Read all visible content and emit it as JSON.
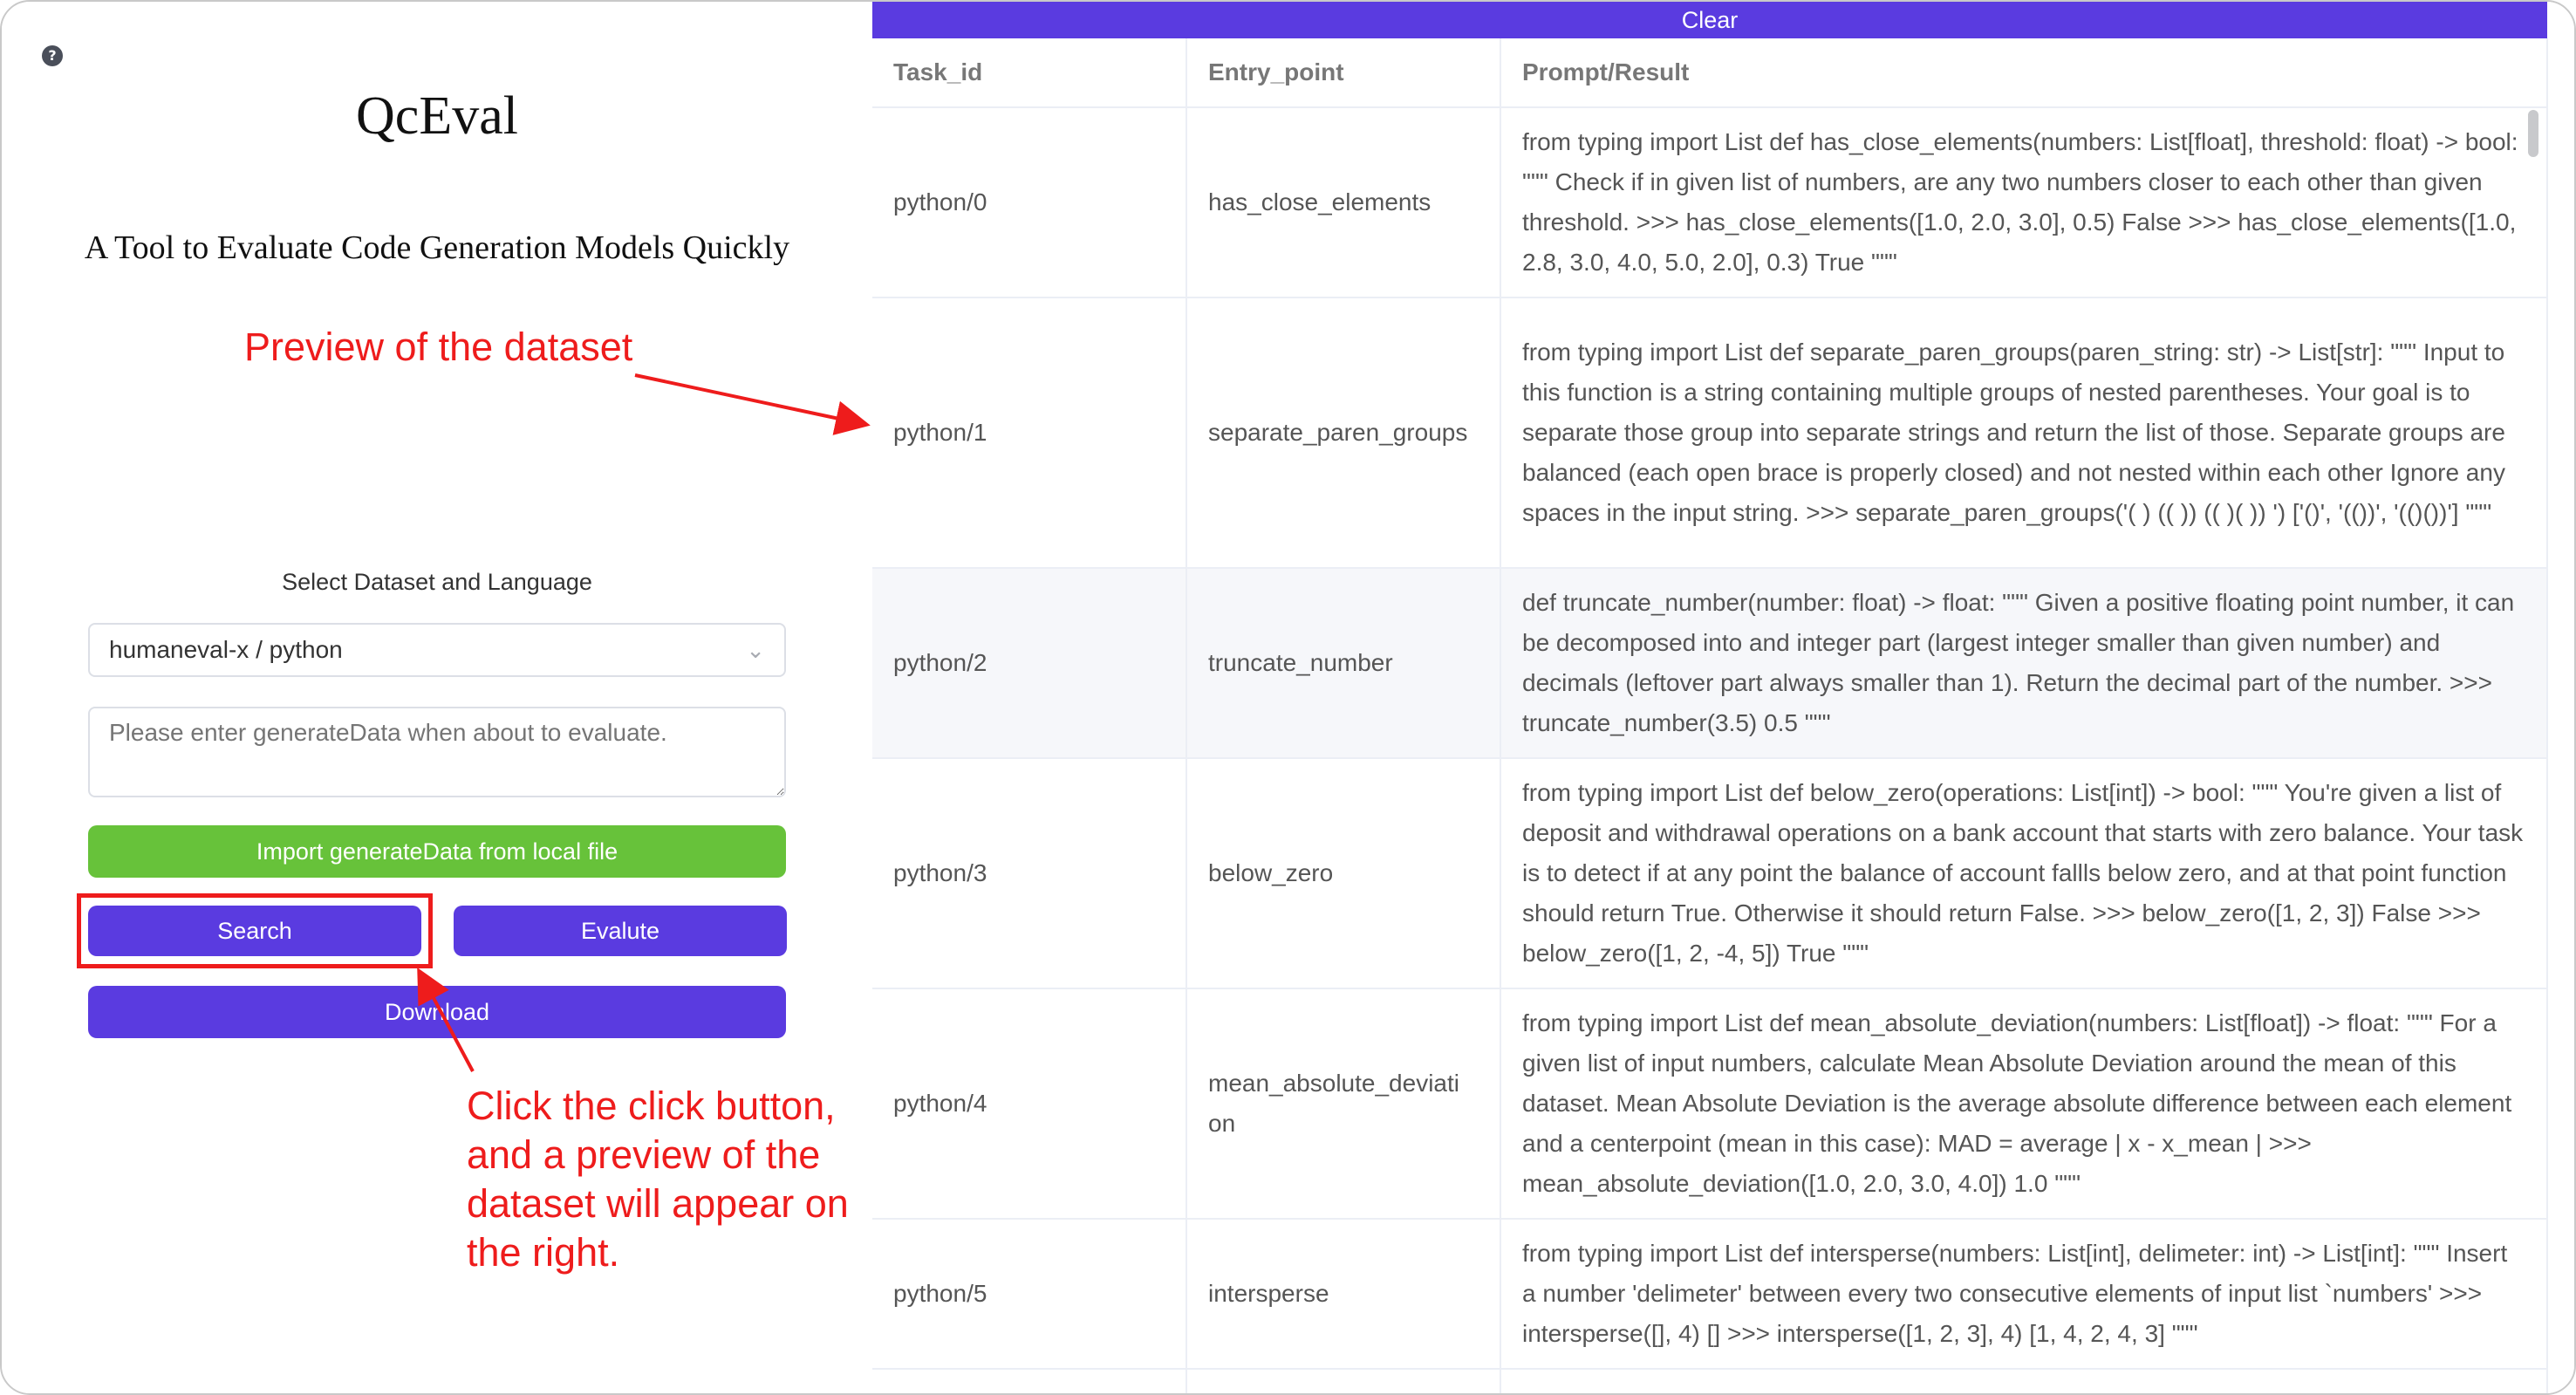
{
  "left": {
    "help_icon": "question-circle-icon",
    "title": "QcEval",
    "subtitle": "A Tool to Evaluate Code Generation Models Quickly",
    "preview_note": "Preview of the dataset",
    "select_label": "Select Dataset and Language",
    "select_value": "humaneval-x / python",
    "input_placeholder": "Please enter generateData when about to evaluate.",
    "import_label": "Import generateData from local file",
    "search_label": "Search",
    "evaluate_label": "Evalute",
    "download_label": "Download",
    "click_note": "Click the click button, and a preview of the dataset will appear on the right."
  },
  "right": {
    "clear_label": "Clear",
    "columns": [
      "Task_id",
      "Entry_point",
      "Prompt/Result"
    ],
    "rows": [
      [
        "python/0",
        "has_close_elements",
        "from typing import List def has_close_elements(numbers: List[float], threshold: float) -> bool: \"\"\" Check if in given list of numbers, are any two numbers closer to each other than given threshold. >>> has_close_elements([1.0, 2.0, 3.0], 0.5) False >>> has_close_elements([1.0, 2.8, 3.0, 4.0, 5.0, 2.0], 0.3) True \"\"\""
      ],
      [
        "python/1",
        "separate_paren_groups",
        "from typing import List def separate_paren_groups(paren_string: str) -> List[str]: \"\"\" Input to this function is a string containing multiple groups of nested parentheses. Your goal is to separate those group into separate strings and return the list of those. Separate groups are balanced (each open brace is properly closed) and not nested within each other Ignore any spaces in the input string. >>> separate_paren_groups('( ) (( )) (( )( )) ') ['()', '(())', '(()())'] \"\"\""
      ],
      [
        "python/2",
        "truncate_number",
        "def truncate_number(number: float) -> float: \"\"\" Given a positive floating point number, it can be decomposed into and integer part (largest integer smaller than given number) and decimals (leftover part always smaller than 1). Return the decimal part of the number. >>> truncate_number(3.5) 0.5 \"\"\""
      ],
      [
        "python/3",
        "below_zero",
        "from typing import List def below_zero(operations: List[int]) -> bool: \"\"\" You're given a list of deposit and withdrawal operations on a bank account that starts with zero balance. Your task is to detect if at any point the balance of account fallls below zero, and at that point function should return True. Otherwise it should return False. >>> below_zero([1, 2, 3]) False >>> below_zero([1, 2, -4, 5]) True \"\"\""
      ],
      [
        "python/4",
        "mean_absolute_deviati on",
        "from typing import List def mean_absolute_deviation(numbers: List[float]) -> float: \"\"\" For a given list of input numbers, calculate Mean Absolute Deviation around the mean of this dataset. Mean Absolute Deviation is the average absolute difference between each element and a centerpoint (mean in this case): MAD = average | x - x_mean | >>> mean_absolute_deviation([1.0, 2.0, 3.0, 4.0]) 1.0 \"\"\""
      ],
      [
        "python/5",
        "intersperse",
        "from typing import List def intersperse(numbers: List[int], delimeter: int) -> List[int]: \"\"\" Insert a number 'delimeter' between every two consecutive elements of input list `numbers' >>> intersperse([], 4) [] >>> intersperse([1, 2, 3], 4) [1, 4, 2, 4, 3] \"\"\""
      ],
      [
        "",
        "",
        ""
      ]
    ]
  }
}
